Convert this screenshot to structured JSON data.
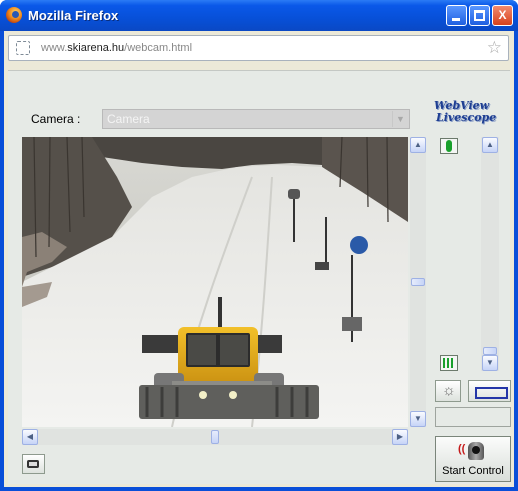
{
  "window": {
    "title": "Mozilla Firefox",
    "minimize_label": "",
    "maximize_label": "",
    "close_label": "X"
  },
  "addressbar": {
    "url_prefix": "www.",
    "url_host": "skiarena.hu",
    "url_path": "/webcam.html"
  },
  "camera": {
    "label": "Camera :",
    "selected": "Camera"
  },
  "logo": {
    "line1": "WebView",
    "line2": "Livescope"
  },
  "scroll": {
    "up_arrow": "▲",
    "down_arrow": "▼",
    "left_arrow": "◀",
    "right_arrow": "▶",
    "vertical_position": 0.5,
    "horizontal_position": 0.5,
    "zoom_position": 1.0
  },
  "controls": {
    "start_control_label": "Start Control",
    "start_control_waves": "(("
  },
  "icons": {
    "browser": "firefox-icon",
    "site": "page-icon",
    "bookmark": "star-icon",
    "zoom_in": "zoom-in-icon",
    "zoom_out": "zoom-out-icon",
    "preset": "preset-icon",
    "frame": "frame-icon",
    "snapshot": "camera-snapshot-icon",
    "start_control": "ptz-camera-icon"
  },
  "colors": {
    "titlebar": "#0a58e8",
    "close_button": "#d8421c",
    "logo": "#1e3e92",
    "groomer": "#e8b41c"
  }
}
